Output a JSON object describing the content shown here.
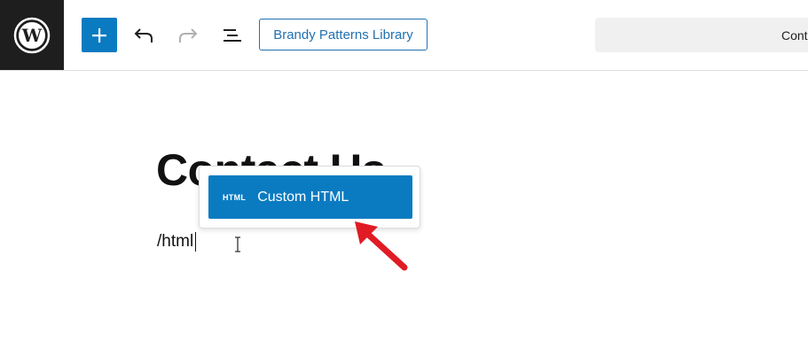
{
  "toolbar": {
    "logo_icon": "wordpress-logo-icon",
    "add_icon": "plus-icon",
    "undo_icon": "undo-icon",
    "redo_icon": "redo-icon",
    "list_view_icon": "list-view-icon",
    "library_label": "Brandy Patterns Library",
    "command_text": "Cont"
  },
  "editor": {
    "heading": "Contact Us",
    "paragraph": "/html"
  },
  "inserter_popover": {
    "items": [
      {
        "badge": "HTML",
        "label": "Custom HTML"
      }
    ]
  },
  "colors": {
    "accent": "#0a7bc1",
    "logo_bg": "#1e1e1e",
    "annotation_arrow": "#e01b24"
  }
}
